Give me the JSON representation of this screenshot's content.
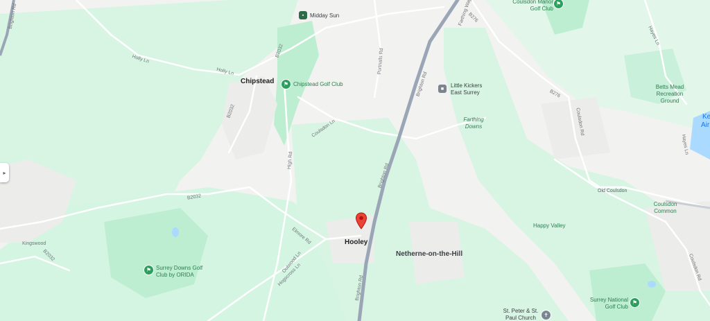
{
  "map": {
    "places": {
      "chipstead": "Chipstead",
      "hooley": "Hooley",
      "netherne": "Netherne-on-the-Hill",
      "old_coulsdon": "Old Coulsdon",
      "coulsdon_common": "Coulsdon Common",
      "happy_valley": "Happy Valley",
      "farthing_downs": "Farthing Downs",
      "kingswood": "Kingswood",
      "kenley_partial": "Ke",
      "airfield_partial": "Air"
    },
    "pois": {
      "midday_sun": "Midday Sun",
      "chipstead_golf": "Chipstead Golf Club",
      "little_kickers": "Little Kickers East Surrey",
      "coulsdon_manor": "Coulsdon Manor Golf Club",
      "betts_mead": "Betts Mead Recreation Ground",
      "surrey_downs": "Surrey Downs Golf Club by ORIDA",
      "surrey_national": "Surrey National Golf Club",
      "st_peter": "St. Peter & St. Paul Church"
    },
    "roads": {
      "brighton_rd": "Brighton Rd",
      "holly_ln": "Holly Ln",
      "b2032": "B2032",
      "high_rd": "High Rd",
      "coulsdon_ln": "Coulsdon Ln",
      "outwood_ln": "Outwood Ln",
      "farthing_way": "Farthing Way",
      "b276": "B276",
      "coulsdon_rd": "Coulsdon Rd",
      "hayes_ln": "Hayes Ln",
      "elmore_rd": "Elmore Rd",
      "hogscross_ln": "Hogscross Ln",
      "portnalls_rd": "Portnalls Rd"
    },
    "icons": {
      "marker": "location-pin-icon",
      "golf": "golf-flag-icon",
      "church": "church-icon",
      "pub": "pub-icon",
      "school": "building-icon",
      "park": "park-icon"
    },
    "colors": {
      "land": "#f2f2f0",
      "park": "#d4f5e2",
      "golf": "#b8ecd0",
      "water": "#aadaff",
      "motorway": "#9aa5b5",
      "road": "#ffffff",
      "marker": "#ea4335"
    }
  }
}
